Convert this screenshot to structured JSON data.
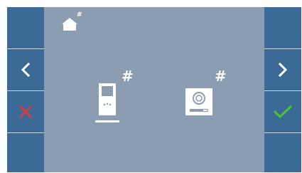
{
  "screen": {
    "background": "#8b9db1",
    "sidebar_color": "#3c6a96"
  },
  "header": {
    "home_icon": "home-icon",
    "home_marker": "#"
  },
  "devices": [
    {
      "name": "monitor",
      "icon": "monitor-icon",
      "marker": "#"
    },
    {
      "name": "door-panel",
      "icon": "door-panel-icon",
      "marker": "#"
    }
  ],
  "left_buttons": [
    {
      "icon": "blank"
    },
    {
      "icon": "chevron-left-icon"
    },
    {
      "icon": "cancel-x-icon",
      "color": "#e8383d"
    },
    {
      "icon": "blank"
    }
  ],
  "right_buttons": [
    {
      "icon": "blank"
    },
    {
      "icon": "chevron-right-icon"
    },
    {
      "icon": "confirm-check-icon",
      "color": "#4fbf3a"
    },
    {
      "icon": "blank"
    }
  ]
}
